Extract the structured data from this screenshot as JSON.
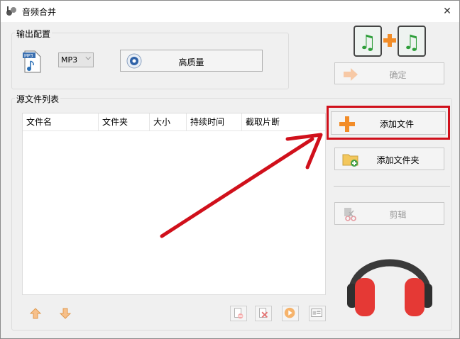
{
  "window": {
    "title": "音频合并",
    "close_glyph": "✕"
  },
  "output_group": {
    "label": "输出配置",
    "format": {
      "selected": "MP3"
    },
    "quality_button": "高质量"
  },
  "confirm_button": "确定",
  "source_group": {
    "label": "源文件列表",
    "columns": [
      "文件名",
      "文件夹",
      "大小",
      "持续时间",
      "截取片断"
    ]
  },
  "buttons": {
    "add_file": "添加文件",
    "add_folder": "添加文件夹",
    "edit": "剪辑"
  },
  "icons": {
    "app": "audio-merge-icon",
    "mp3": "mp3-file-icon",
    "quality": "quality-icon",
    "merge": "music-merge-icon",
    "confirm": "confirm-arrow-icon",
    "add_file": "plus-icon",
    "add_folder": "folder-add-icon",
    "edit": "scissors-icon",
    "move_up": "arrow-up-icon",
    "move_down": "arrow-down-icon",
    "remove": "remove-file-icon",
    "clear": "clear-list-icon",
    "play": "play-icon",
    "info": "info-card-icon",
    "headphones": "headphones-icon"
  },
  "colors": {
    "highlight": "#d0101b",
    "accent_orange": "#f28c28",
    "headphone_red": "#e53935"
  }
}
